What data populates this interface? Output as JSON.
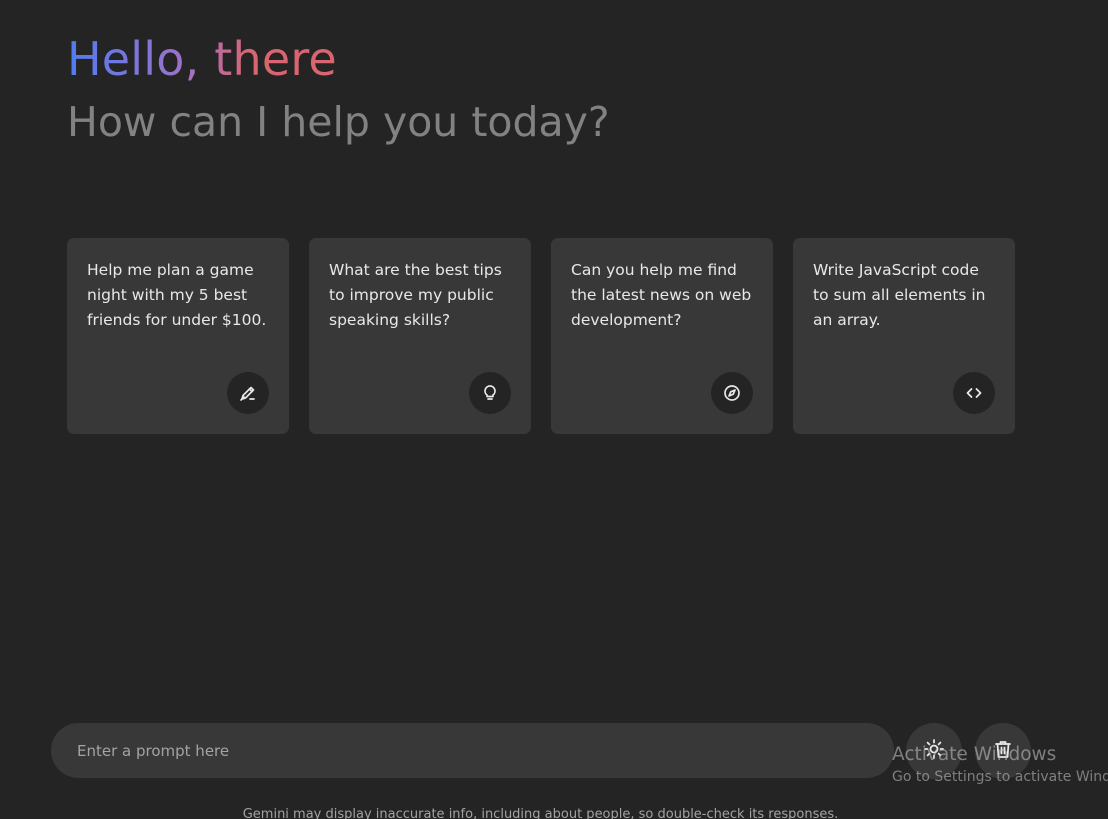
{
  "header": {
    "greeting": "Hello, there",
    "subtitle": "How can I help you today?"
  },
  "suggestions": [
    {
      "text": "Help me plan a game night with my 5 best friends for under $100.",
      "icon": "draw-icon"
    },
    {
      "text": "What are the best tips to improve my public speaking skills?",
      "icon": "lightbulb-icon"
    },
    {
      "text": "Can you help me find the latest news on web development?",
      "icon": "explore-icon"
    },
    {
      "text": "Write JavaScript code to sum all elements in an array.",
      "icon": "code-icon"
    }
  ],
  "prompt": {
    "placeholder": "Enter a prompt here"
  },
  "actions": {
    "theme_icon": "light-mode-icon",
    "delete_icon": "delete-icon"
  },
  "footer": {
    "disclaimer": "Gemini may display inaccurate info, including about people, so double-check its responses."
  },
  "watermark": {
    "title": "Activate Windows",
    "subtitle": "Go to Settings to activate Windows."
  },
  "colors": {
    "background": "#242424",
    "card": "#383838",
    "gradient_start": "#4f7bf0",
    "gradient_mid": "#9b72cb",
    "gradient_end": "#d96570"
  }
}
